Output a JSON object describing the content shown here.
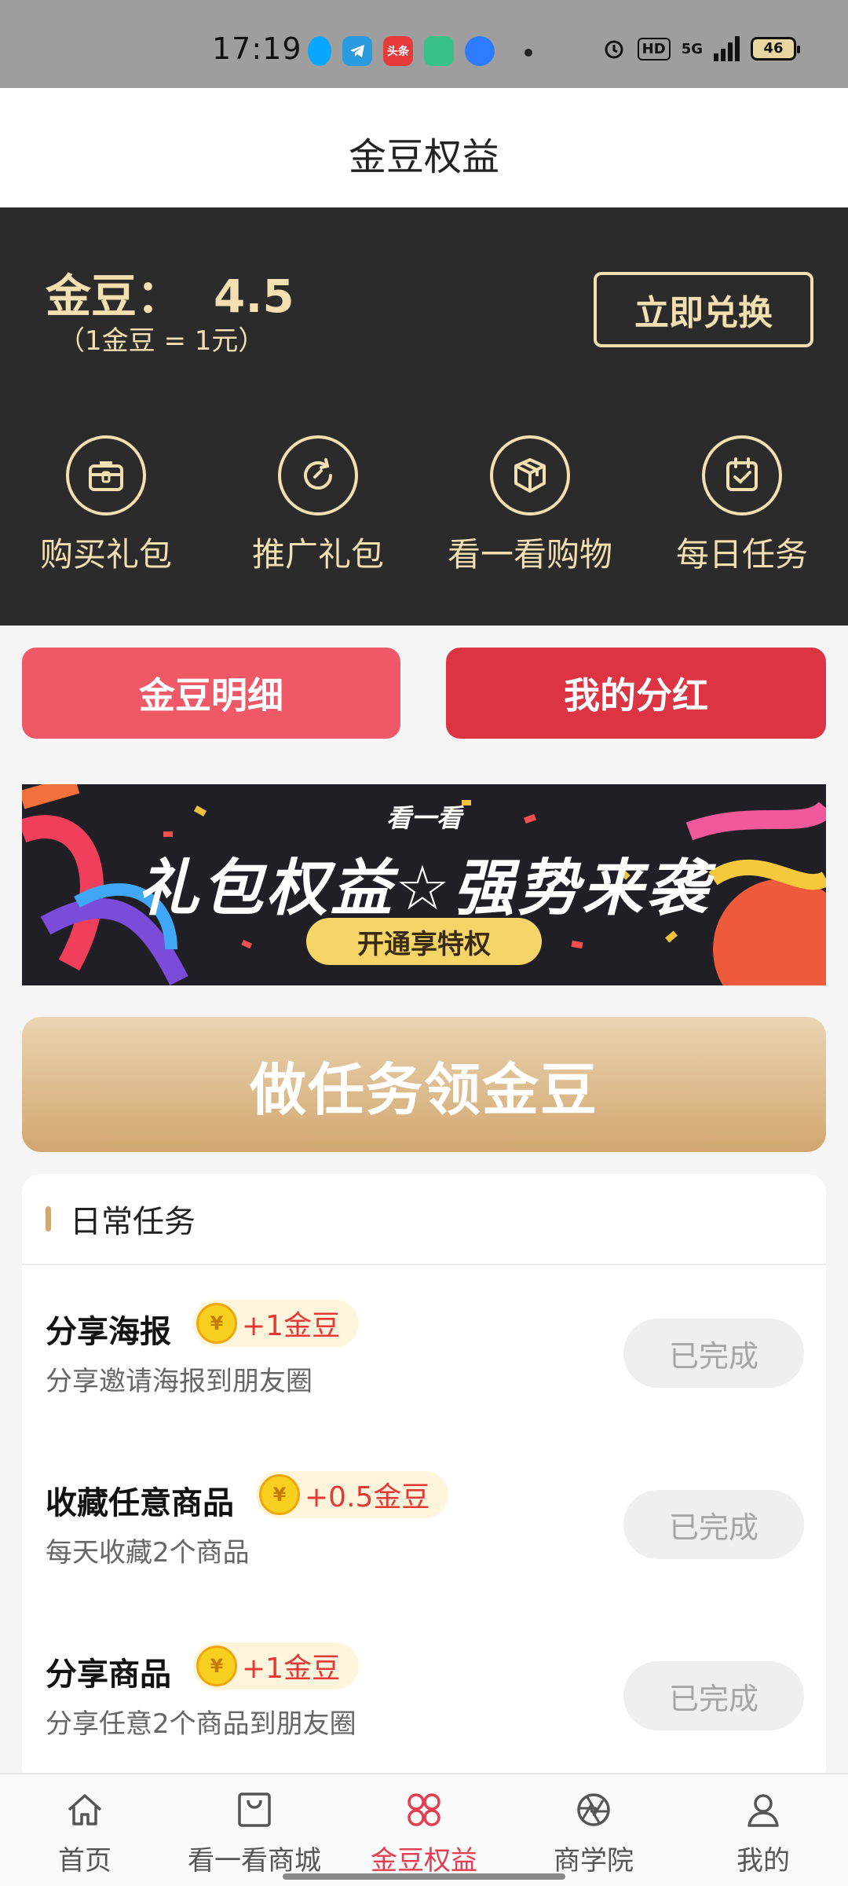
{
  "status_bar": {
    "time": "17:19",
    "app_icons": [
      {
        "name": "qq-icon",
        "color": "#0aa7ff",
        "text": ""
      },
      {
        "name": "telegram-icon",
        "color": "#2b9be0",
        "text": ""
      },
      {
        "name": "toutiao-icon",
        "color": "#e73b3b",
        "text": "头条"
      },
      {
        "name": "app-green-icon",
        "color": "#38c28a",
        "text": ""
      },
      {
        "name": "browser-icon",
        "color": "#2d7cff",
        "text": ""
      }
    ],
    "hd_label": "HD",
    "network": "5G",
    "battery": "46"
  },
  "header": {
    "title": "金豆权益"
  },
  "balance": {
    "label": "金豆：",
    "value": "4.5",
    "rate": "（1金豆 = 1元）",
    "exchange_label": "立即兑换"
  },
  "quick_actions": [
    {
      "label": "购买礼包",
      "icon": "gift-box-icon"
    },
    {
      "label": "推广礼包",
      "icon": "refresh-icon"
    },
    {
      "label": "看一看购物",
      "icon": "package-icon"
    },
    {
      "label": "每日任务",
      "icon": "calendar-check-icon"
    }
  ],
  "buttons": {
    "detail": "金豆明细",
    "dividend": "我的分红"
  },
  "banner": {
    "subtitle": "看一看",
    "title": "礼包权益☆强势来袭",
    "cta": "开通享特权"
  },
  "task_header": "做任务领金豆",
  "task_section": {
    "title": "日常任务",
    "tasks": [
      {
        "name": "分享海报",
        "reward": "+1金豆",
        "desc": "分享邀请海报到朋友圈",
        "status": "已完成"
      },
      {
        "name": "收藏任意商品",
        "reward": "+0.5金豆",
        "desc": "每天收藏2个商品",
        "status": "已完成"
      },
      {
        "name": "分享商品",
        "reward": "+1金豆",
        "desc": "分享任意2个商品到朋友圈",
        "status": "已完成"
      }
    ]
  },
  "coin_symbol": "¥",
  "nav": [
    {
      "label": "首页",
      "icon": "home-icon",
      "active": false
    },
    {
      "label": "看一看商城",
      "icon": "shopping-bag-icon",
      "active": false
    },
    {
      "label": "金豆权益",
      "icon": "clover-icon",
      "active": true
    },
    {
      "label": "商学院",
      "icon": "aperture-icon",
      "active": false
    },
    {
      "label": "我的",
      "icon": "user-icon",
      "active": false
    }
  ],
  "colors": {
    "gold": "#f3dfb0",
    "dark_bg": "#2b2b2b",
    "red_light": "#ef5866",
    "red_dark": "#dc3443",
    "active_nav": "#e43d4f"
  }
}
